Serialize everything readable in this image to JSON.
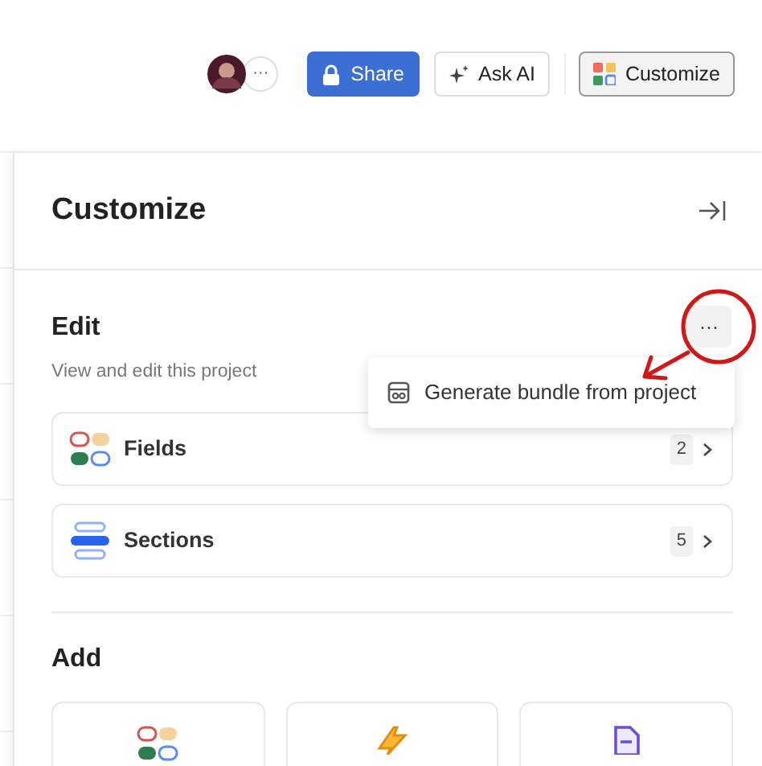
{
  "toolbar": {
    "more_label": "···",
    "buttons": [
      {
        "kind": "share",
        "label": "Share"
      },
      {
        "kind": "ai",
        "label": "Ask AI"
      },
      {
        "kind": "customize",
        "label": "Customize"
      }
    ]
  },
  "panel": {
    "title": "Customize",
    "edit": {
      "title": "Edit",
      "subtitle": "View and edit this project",
      "more_label": "···",
      "menu": [
        {
          "label": "Generate bundle from project"
        }
      ],
      "items": [
        {
          "kind": "fields",
          "label": "Fields",
          "count": "2"
        },
        {
          "kind": "sections",
          "label": "Sections",
          "count": "5"
        }
      ]
    },
    "add": {
      "title": "Add",
      "cards": [
        {
          "kind": "fields"
        },
        {
          "kind": "automation"
        },
        {
          "kind": "form"
        }
      ]
    }
  }
}
